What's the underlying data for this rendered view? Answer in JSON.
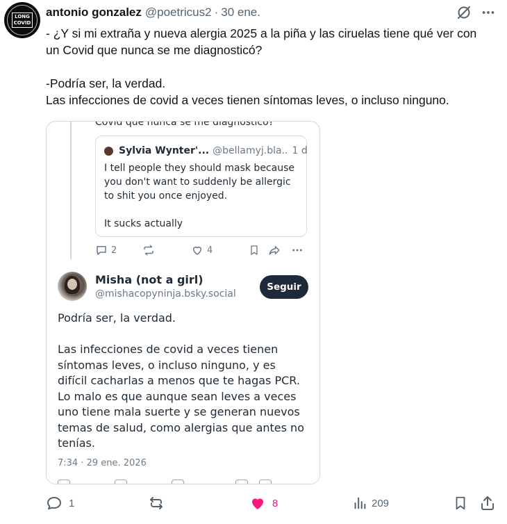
{
  "post": {
    "author_name": "antonio gonzalez",
    "handle": "@poetricus2",
    "separator": "·",
    "date": "30 ene.",
    "avatar_badge": [
      "LONG",
      "COVID"
    ],
    "icons": {
      "grok": "slashed-circle-icon",
      "more": "more-horizontal-icon"
    },
    "text": [
      "- ¿Y si mi extraña y nueva alergia 2025 a la piña y las ciruelas tiene qué ver con un Covid que nunca se me diagnosticó?",
      "",
      "-Podría ser, la verdad.",
      "Las infecciones de covid a veces tienen síntomas leves, o incluso ninguno."
    ]
  },
  "embed": {
    "cut_line": "Covid que nunca se me diagnosticó?",
    "quote": {
      "name": "Sylvia Wynter'...",
      "handle": "@bellamyj.bla..",
      "time": "1 d",
      "lines": [
        "I tell people they should mask because",
        "you don't want to suddenly be allergic",
        "to shit you once enjoyed.",
        "",
        "It sucks actually"
      ]
    },
    "parent_actions": {
      "replies": "2",
      "reposts": "",
      "likes": "4"
    },
    "reply": {
      "name": "Misha (not a girl)",
      "handle": "@mishacopyninja.bsky.social",
      "follow_label": "Seguir",
      "body": [
        "Podría ser, la verdad.",
        "",
        "Las infecciones de covid a veces tienen",
        "síntomas leves, o incluso ninguno, y es",
        "difícil cacharlas a menos que te hagas PCR.",
        "Lo malo es que aunque sean leves a veces",
        "uno tiene mala suerte y se generan nuevos",
        "temas de salud, como alergias que antes no",
        "tenías."
      ],
      "timestamp": "7:34 · 29 ene. 2026"
    }
  },
  "actions": {
    "replies": "1",
    "reposts": "",
    "likes": "8",
    "views": "209",
    "like_color": "#f91880"
  },
  "colors": {
    "text": "#0f1419",
    "muted": "#536471",
    "follow_bg": "#1e2a3a"
  }
}
